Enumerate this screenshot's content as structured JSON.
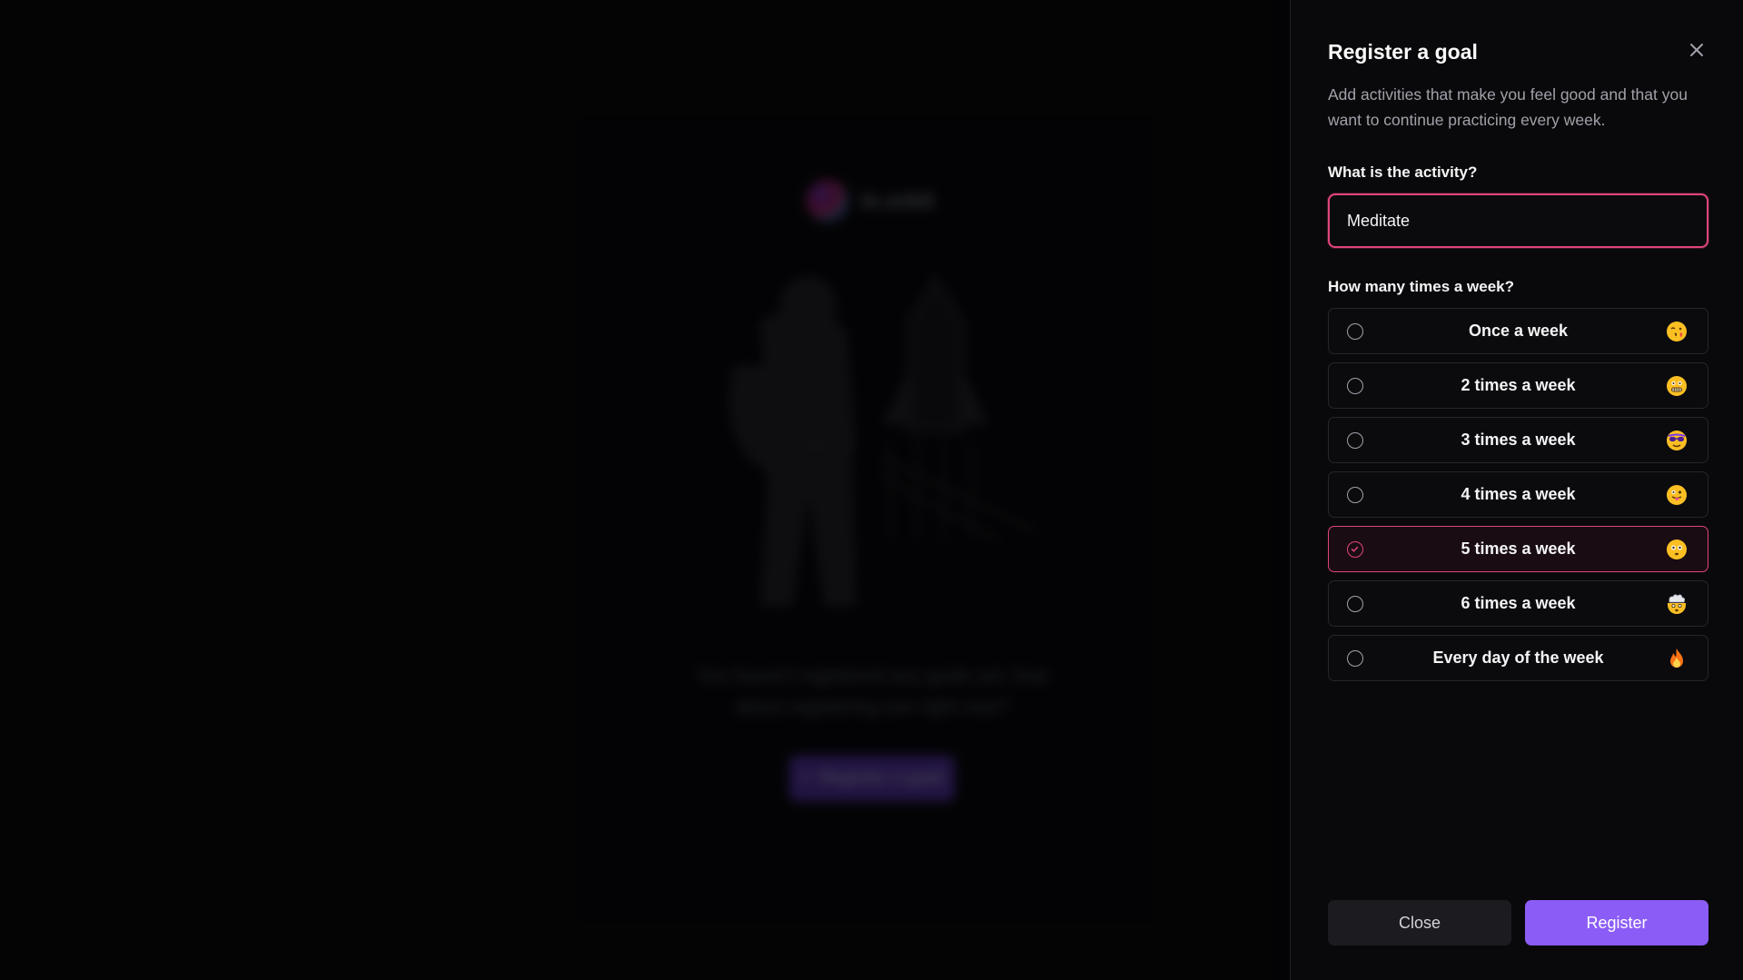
{
  "background": {
    "logo_text": "in.orbit",
    "empty_message": "You haven't registered any goals yet, how about registering one right now?",
    "register_button_label": "Register a goal"
  },
  "panel": {
    "title": "Register a goal",
    "description": "Add activities that make you feel good and that you want to continue practicing every week.",
    "activity_label": "What is the activity?",
    "activity_value": "Meditate",
    "frequency_label": "How many times a week?",
    "options": [
      {
        "label": "Once a week",
        "emoji": "face-blowing-kiss",
        "selected": false
      },
      {
        "label": "2 times a week",
        "emoji": "grimacing-face",
        "selected": false
      },
      {
        "label": "3 times a week",
        "emoji": "sunglasses-face",
        "selected": false
      },
      {
        "label": "4 times a week",
        "emoji": "tongue-face",
        "selected": false
      },
      {
        "label": "5 times a week",
        "emoji": "flushed-face",
        "selected": true
      },
      {
        "label": "6 times a week",
        "emoji": "mind-blown-face",
        "selected": false
      },
      {
        "label": "Every day of the week",
        "emoji": "fire",
        "selected": false
      }
    ],
    "close_button": "Close",
    "register_button": "Register"
  },
  "colors": {
    "accent_pink": "#e0457b",
    "primary_violet": "#8b5cf6",
    "panel_bg": "#09090b"
  }
}
